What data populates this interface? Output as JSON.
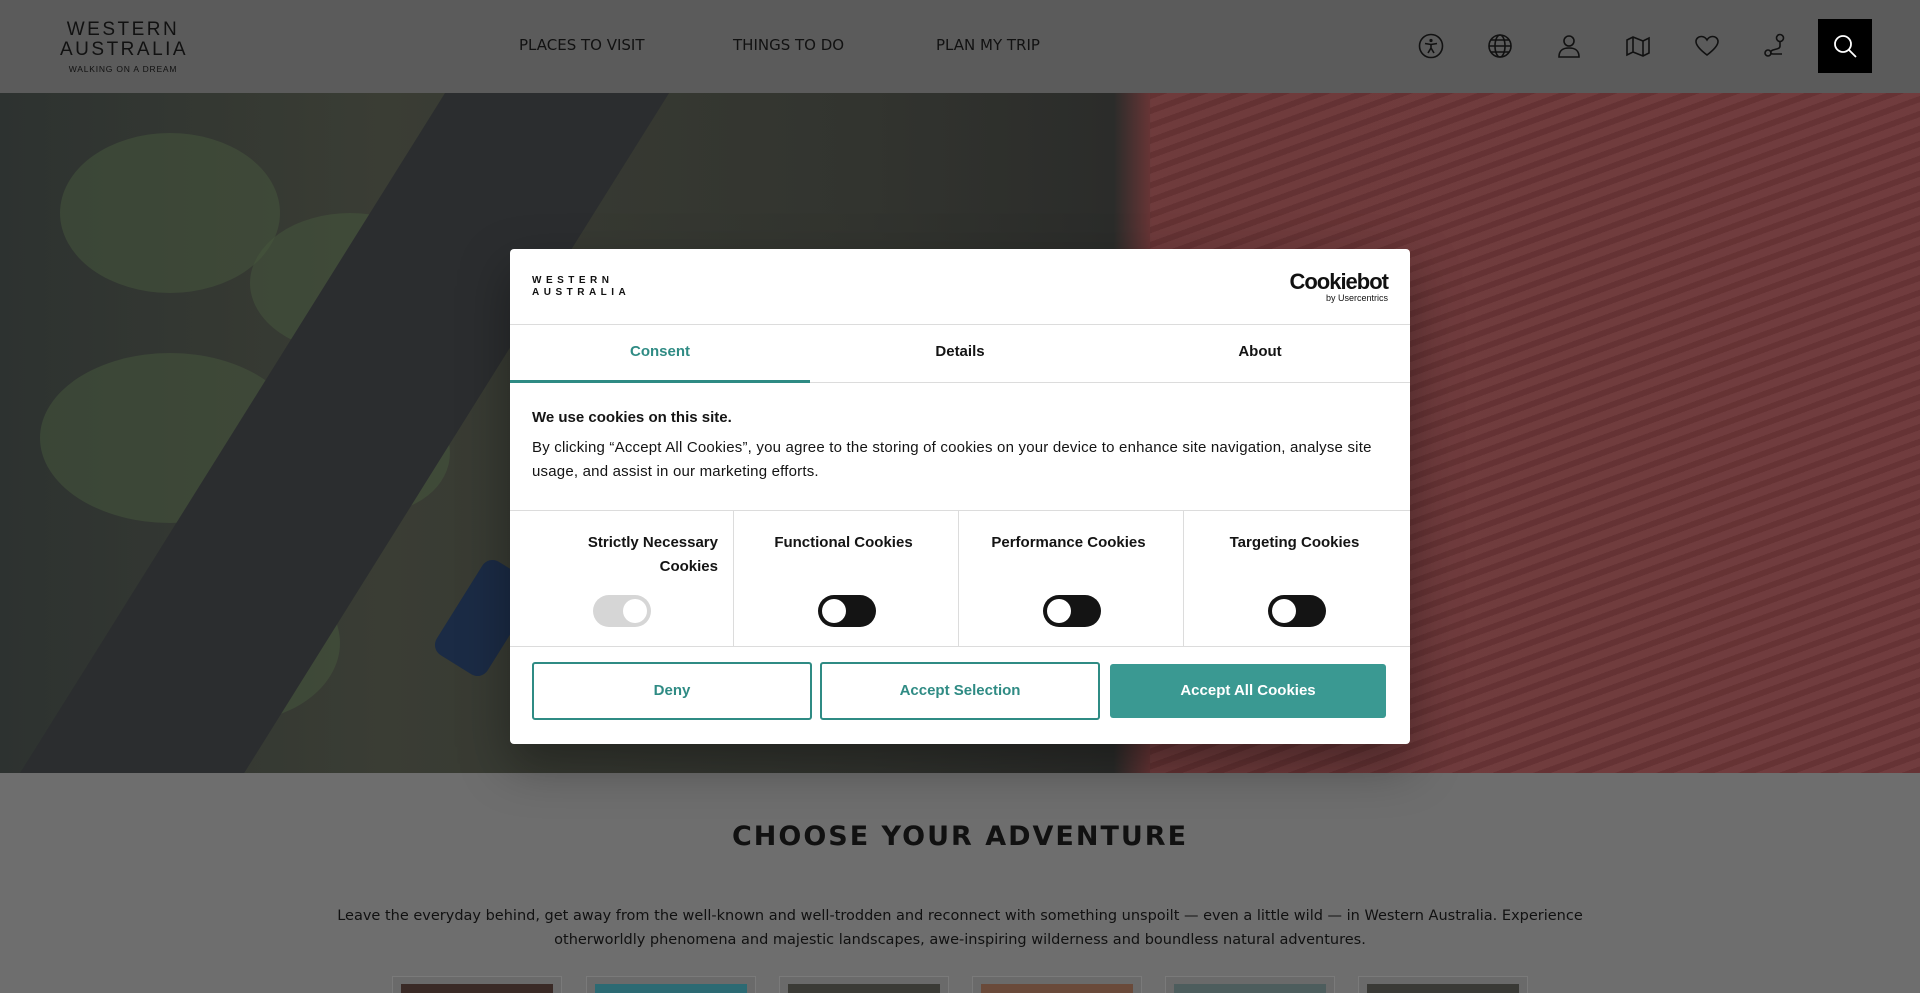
{
  "header": {
    "logo": {
      "line1": "WESTERN",
      "line2": "AUSTRALIA",
      "tagline": "WALKING ON A DREAM"
    },
    "nav": [
      "PLACES TO VISIT",
      "THINGS TO DO",
      "PLAN MY TRIP"
    ],
    "icons": [
      "accessibility-icon",
      "globe-icon",
      "user-icon",
      "map-icon",
      "heart-icon",
      "trip-planner-icon",
      "search-icon"
    ]
  },
  "section": {
    "title": "CHOOSE YOUR ADVENTURE",
    "description": "Leave the everyday behind, get away from the well-known and well-trodden and reconnect with something unspoilt — even a little wild — in Western Australia. Experience otherworldly phenomena and majestic landscapes, awe-inspiring wilderness and boundless natural adventures."
  },
  "dialog": {
    "logo": {
      "line1": "WESTERN",
      "line2": "AUSTRALIA"
    },
    "provider": {
      "name": "Cookiebot",
      "by": "by Usercentrics"
    },
    "tabs": [
      "Consent",
      "Details",
      "About"
    ],
    "active_tab": "Consent",
    "title": "We use cookies on this site.",
    "text": "By clicking “Accept All Cookies”, you agree to the storing of cookies on your device to enhance site navigation, analyse site usage, and assist in our marketing efforts.",
    "categories": [
      {
        "label": "Strictly Necessary Cookies",
        "enabled": true,
        "disabled": true
      },
      {
        "label": "Functional Cookies",
        "enabled": false,
        "disabled": false
      },
      {
        "label": "Performance Cookies",
        "enabled": false,
        "disabled": false
      },
      {
        "label": "Targeting Cookies",
        "enabled": false,
        "disabled": false
      }
    ],
    "buttons": {
      "deny": "Deny",
      "accept_selection": "Accept Selection",
      "accept_all": "Accept All Cookies"
    }
  },
  "colors": {
    "accent": "#2f8b84",
    "accept_all_bg": "#3a9992",
    "overlay_page": "#6b6b6b"
  }
}
